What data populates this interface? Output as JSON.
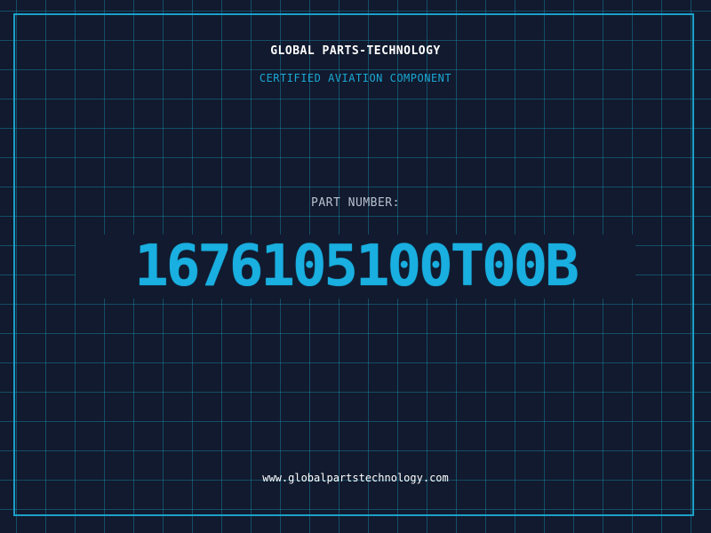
{
  "header": {
    "company": "GLOBAL PARTS-TECHNOLOGY",
    "tagline": "CERTIFIED AVIATION COMPONENT"
  },
  "part": {
    "label": "PART NUMBER:",
    "number": "1676105100T00B"
  },
  "footer": {
    "website": "www.globalpartstechnology.com"
  },
  "colors": {
    "background": "#111a2e",
    "grid": "#1a8caa",
    "frame": "#1ba0c8",
    "accent": "#19afe0",
    "heading": "#ffffff",
    "label": "#b6c2d0"
  }
}
